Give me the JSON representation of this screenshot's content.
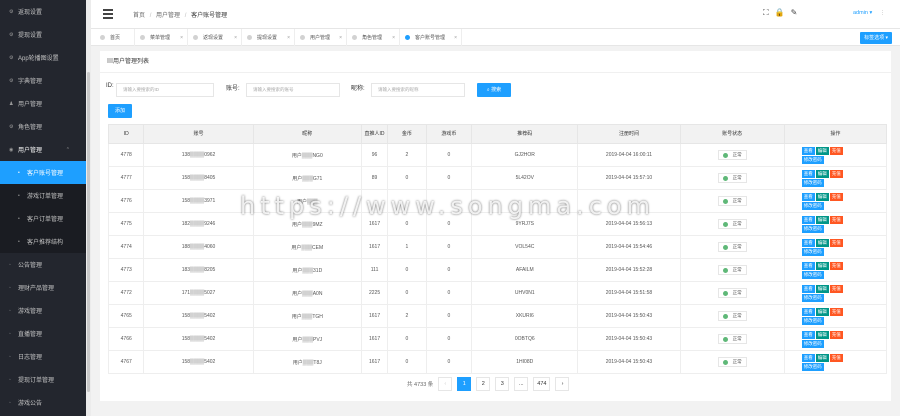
{
  "sidebar": {
    "items": [
      {
        "icon": "gear-icon",
        "glyph": "⚙",
        "label": "返现设置"
      },
      {
        "icon": "gear-icon",
        "glyph": "⚙",
        "label": "提现设置"
      },
      {
        "icon": "gear-icon",
        "glyph": "⚙",
        "label": "App轮播图设置"
      },
      {
        "icon": "gear-icon",
        "glyph": "⚙",
        "label": "字典管理"
      },
      {
        "icon": "user-icon",
        "glyph": "♟",
        "label": "用户管理"
      },
      {
        "icon": "gear-icon",
        "glyph": "⚙",
        "label": "角色管理"
      }
    ],
    "open_group": {
      "label": "用户管理",
      "arrow": "⌃"
    },
    "sub_items": [
      {
        "label": "客户账号管理",
        "active": true
      },
      {
        "label": "游戏订单管理",
        "active": false
      },
      {
        "label": "客户订单管理",
        "active": false
      },
      {
        "label": "客户推荐结构",
        "active": false
      }
    ],
    "groups": [
      {
        "label": "公告管理"
      },
      {
        "label": "理财产品管理"
      },
      {
        "label": "游戏管理"
      },
      {
        "label": "直播管理"
      },
      {
        "label": "日志管理"
      },
      {
        "label": "提现订单管理"
      },
      {
        "label": "游戏公告"
      }
    ]
  },
  "header": {
    "breadcrumb": [
      "首页",
      "用户管理",
      "客户账号管理"
    ],
    "separator": "/",
    "icons": [
      {
        "name": "fullscreen-icon",
        "glyph": "⛶"
      },
      {
        "name": "lock-icon",
        "glyph": "🔒"
      },
      {
        "name": "theme-icon",
        "glyph": "✎"
      }
    ],
    "user": "admin ▾",
    "more": "⋮"
  },
  "tabs": [
    {
      "label": "首页",
      "active": false
    },
    {
      "label": "菜单管理",
      "active": false
    },
    {
      "label": "返现设置",
      "active": false
    },
    {
      "label": "提现设置",
      "active": false
    },
    {
      "label": "用户管理",
      "active": false
    },
    {
      "label": "角色管理",
      "active": false
    },
    {
      "label": "客户账号管理",
      "active": true
    }
  ],
  "tab_close": "×",
  "tab_ops": "标签选项 ▾",
  "card": {
    "title": "▤用户管理列表",
    "search": {
      "id_label": "ID:",
      "id_placeholder": "请输入要搜索的ID",
      "account_label": "账号:",
      "account_placeholder": "请输入要搜索的账号",
      "nick_label": "昵称:",
      "nick_placeholder": "请输入要搜索的昵称",
      "button": "⌕ 搜索"
    },
    "add_button": "添加"
  },
  "table": {
    "headers": [
      "ID",
      "账号",
      "昵称",
      "直推人ID",
      "金币",
      "游戏币",
      "推荐码",
      "注册时间",
      "账号状态",
      "操作"
    ],
    "status_label": "正常",
    "actions": {
      "view": "查看",
      "edit": "编辑",
      "charge": "充值",
      "pwd": "修改密码"
    },
    "rows": [
      {
        "id": "4778",
        "account": "138▒▒▒▒0962",
        "nick": "用户▒▒▒NG0",
        "ref": "96",
        "gold": "2",
        "game": "0",
        "code": "GJ2HOR",
        "time": "2019-04-04 16:00:11"
      },
      {
        "id": "4777",
        "account": "158▒▒▒▒8405",
        "nick": "用户▒▒▒G71",
        "ref": "89",
        "gold": "0",
        "game": "0",
        "code": "5L42OV",
        "time": "2019-04-04 15:57:10"
      },
      {
        "id": "4776",
        "account": "158▒▒▒▒3971",
        "nick": "用户▒▒▒",
        "ref": "",
        "gold": "",
        "game": "",
        "code": "",
        "time": ""
      },
      {
        "id": "4775",
        "account": "182▒▒▒▒9246",
        "nick": "用户▒▒▒9MZ",
        "ref": "1617",
        "gold": "0",
        "game": "0",
        "code": "9YRJ7S",
        "time": "2019-04-04 15:56:13"
      },
      {
        "id": "4774",
        "account": "188▒▒▒▒4060",
        "nick": "用户▒▒▒CEM",
        "ref": "1617",
        "gold": "1",
        "game": "0",
        "code": "VOL54C",
        "time": "2019-04-04 15:54:46"
      },
      {
        "id": "4773",
        "account": "183▒▒▒▒8205",
        "nick": "用户▒▒▒31D",
        "ref": "111",
        "gold": "0",
        "game": "0",
        "code": "AFAILM",
        "time": "2019-04-04 15:52:28"
      },
      {
        "id": "4772",
        "account": "171▒▒▒▒5027",
        "nick": "用户▒▒▒A0N",
        "ref": "2225",
        "gold": "0",
        "game": "0",
        "code": "UHV0N1",
        "time": "2019-04-04 15:51:58"
      },
      {
        "id": "4765",
        "account": "158▒▒▒▒5402",
        "nick": "用户▒▒▒TGH",
        "ref": "1617",
        "gold": "2",
        "game": "0",
        "code": "XKURI6",
        "time": "2019-04-04 15:50:43"
      },
      {
        "id": "4766",
        "account": "158▒▒▒▒5402",
        "nick": "用户▒▒▒PVJ",
        "ref": "1617",
        "gold": "0",
        "game": "0",
        "code": "0OBTQ6",
        "time": "2019-04-04 15:50:43"
      },
      {
        "id": "4767",
        "account": "158▒▒▒▒5402",
        "nick": "用户▒▒▒T8J",
        "ref": "1617",
        "gold": "0",
        "game": "0",
        "code": "1HI08D",
        "time": "2019-04-04 15:50:43"
      }
    ]
  },
  "pager": {
    "total": "共 4733 条",
    "prev": "‹",
    "pages": [
      "1",
      "2",
      "3"
    ],
    "ellipsis": "...",
    "last": "474",
    "next": "›",
    "current": "1"
  },
  "watermark": "https://www.songma.com",
  "colors": {
    "primary": "#1e9fff",
    "sidebar": "#23262e",
    "edit": "#009688",
    "charge": "#ff5722",
    "status_dot": "#5fb878"
  }
}
